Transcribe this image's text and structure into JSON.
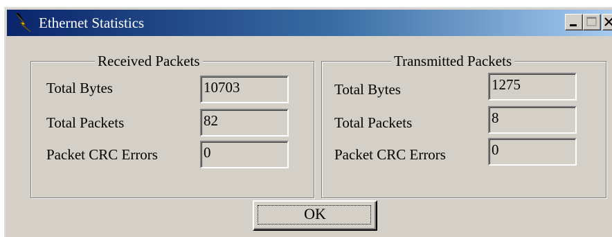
{
  "window": {
    "title": "Ethernet Statistics",
    "icon": "lightning-bolt-icon",
    "controls": [
      "minimize-icon",
      "maximize-icon",
      "close-icon"
    ]
  },
  "received": {
    "legend": "Received Packets",
    "rows": [
      {
        "label": "Total Bytes",
        "value": "10703"
      },
      {
        "label": "Total Packets",
        "value": "82"
      },
      {
        "label": "Packet CRC Errors",
        "value": "0"
      }
    ]
  },
  "transmitted": {
    "legend": "Transmitted Packets",
    "rows": [
      {
        "label": "Total Bytes",
        "value": "1275"
      },
      {
        "label": "Total Packets",
        "value": "8"
      },
      {
        "label": "Packet CRC Errors",
        "value": "0"
      }
    ]
  },
  "ok_label": "OK",
  "colors": {
    "title_start": "#0a246a",
    "title_end": "#a6caf0",
    "face": "#d4d0c8"
  }
}
